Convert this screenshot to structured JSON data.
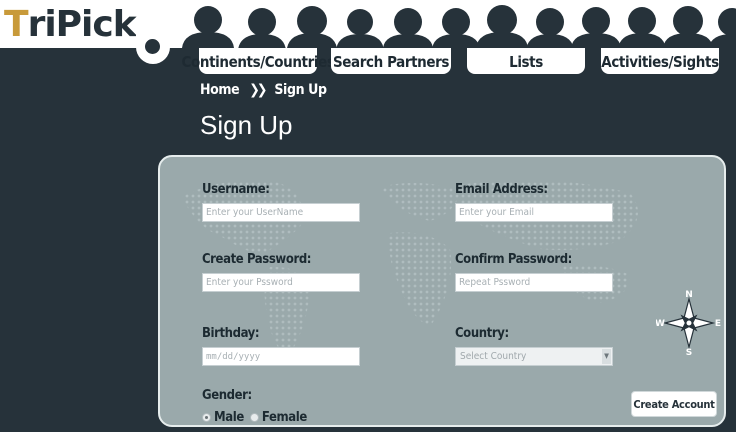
{
  "logo": {
    "first_letter": "T",
    "rest": "riPick"
  },
  "nav": {
    "tabs": [
      {
        "label": "Continents/Countries"
      },
      {
        "label": "Search Partners"
      },
      {
        "label": "Lists"
      },
      {
        "label": "Activities/Sights"
      }
    ]
  },
  "breadcrumb": {
    "home": "Home",
    "separator": "❯❯",
    "current": "Sign Up"
  },
  "page": {
    "title": "Sign Up"
  },
  "form": {
    "username": {
      "label": "Username:",
      "placeholder": "Enter your UserName"
    },
    "email": {
      "label": "Email Address:",
      "placeholder": "Enter your Email"
    },
    "password": {
      "label": "Create Password:",
      "placeholder": "Enter your Pssword"
    },
    "confirm": {
      "label": "Confirm Password:",
      "placeholder": "Repeat Pssword"
    },
    "birthday": {
      "label": "Birthday:",
      "placeholder": "mm/dd/yyyy"
    },
    "country": {
      "label": "Country:",
      "selected": "Select Country"
    },
    "gender": {
      "label": "Gender:",
      "options": [
        "Male",
        "Female"
      ],
      "selected": "Male"
    },
    "submit": "Create Account"
  },
  "compass": {
    "n": "N",
    "e": "E",
    "s": "S",
    "w": "W"
  },
  "colors": {
    "background": "#26323a",
    "panel": "#9aa9ab",
    "accent": "#c89a3a"
  }
}
